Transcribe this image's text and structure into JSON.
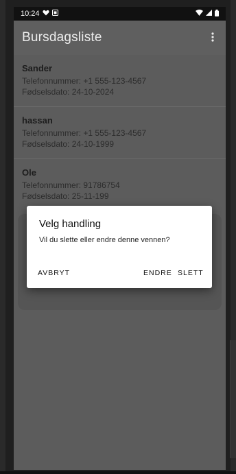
{
  "status_bar": {
    "time": "10:24",
    "icons": [
      "heart-notification-icon",
      "media-icon",
      "wifi-icon",
      "signal-icon",
      "battery-icon"
    ]
  },
  "app_bar": {
    "title": "Bursdagsliste",
    "overflow_icon": "more-vert-icon"
  },
  "contacts": [
    {
      "name": "Sander",
      "phone": "Telefonnummer: +1 555-123-4567",
      "birthdate": "Fødselsdato: 24-10-2024"
    },
    {
      "name": "hassan",
      "phone": "Telefonnummer: +1 555-123-4567",
      "birthdate": "Fødselsdato: 24-10-1999"
    },
    {
      "name": "Ole",
      "phone": "Telefonnummer: 91786754",
      "birthdate": "Fødselsdato: 25-11-199"
    }
  ],
  "dialog": {
    "title": "Velg handling",
    "message": "Vil du slette eller endre denne vennen?",
    "cancel_label": "AVBRYT",
    "edit_label": "ENDRE",
    "delete_label": "SLETT"
  },
  "colors": {
    "scrim_background": "#5c5c5c",
    "dialog_background": "#ffffff",
    "status_bar": "#111111"
  }
}
